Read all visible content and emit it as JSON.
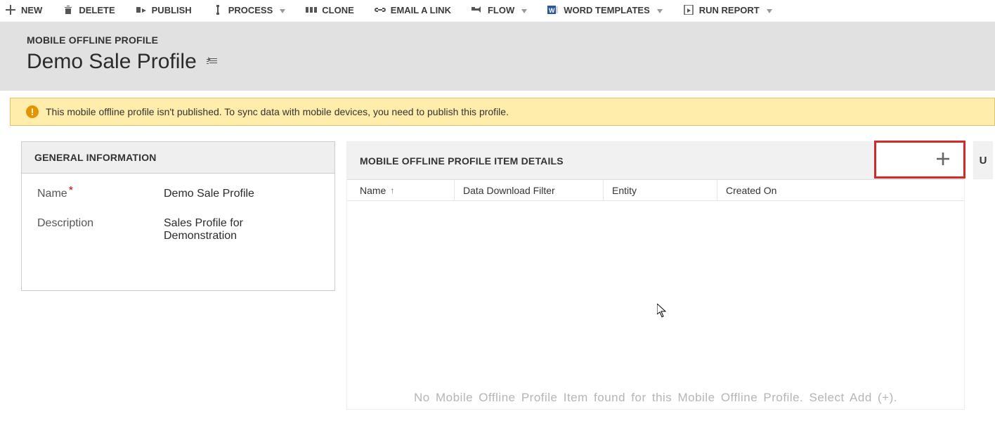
{
  "toolbar": {
    "new": "NEW",
    "delete": "DELETE",
    "publish": "PUBLISH",
    "process": "PROCESS",
    "clone": "CLONE",
    "email_link": "EMAIL A LINK",
    "flow": "FLOW",
    "word_templates": "WORD TEMPLATES",
    "run_report": "RUN REPORT"
  },
  "header": {
    "subtitle": "MOBILE OFFLINE PROFILE",
    "title": "Demo Sale Profile"
  },
  "warning": {
    "message": "This mobile offline profile isn't published. To sync data with mobile devices, you need to publish this profile."
  },
  "left_panel": {
    "title": "GENERAL INFORMATION",
    "fields": {
      "name_label": "Name",
      "name_value": "Demo Sale Profile",
      "desc_label": "Description",
      "desc_value": "Sales Profile for Demonstration"
    }
  },
  "right_panel": {
    "title": "MOBILE OFFLINE PROFILE ITEM DETAILS",
    "columns": {
      "name": "Name",
      "ddf": "Data Download Filter",
      "entity": "Entity",
      "created": "Created On"
    },
    "empty": "No Mobile Offline Profile Item found for this Mobile Offline Profile. Select Add (+).",
    "sliver_letter": "U"
  }
}
